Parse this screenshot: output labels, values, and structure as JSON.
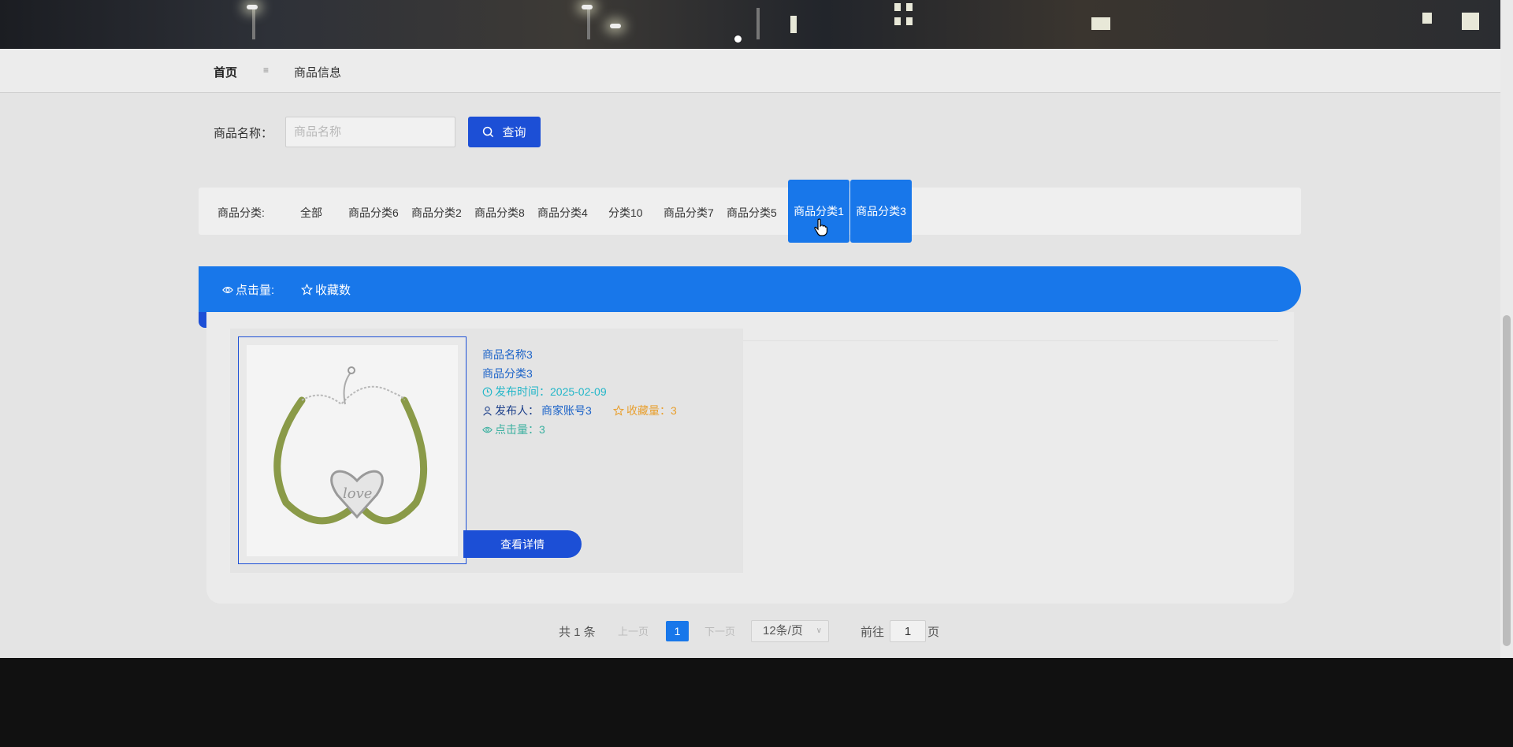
{
  "nav": {
    "home": "首页",
    "separator": "≡",
    "current": "商品信息"
  },
  "search": {
    "label": "商品名称：",
    "placeholder": "商品名称",
    "button": "查询"
  },
  "categories": {
    "label": "商品分类:",
    "items": [
      "全部",
      "商品分类6",
      "商品分类2",
      "商品分类8",
      "商品分类4",
      "分类10",
      "商品分类7",
      "商品分类5"
    ],
    "active": [
      "商品分类1",
      "商品分类3"
    ]
  },
  "sort": {
    "clicks": "点击量:",
    "favorites": "收藏数"
  },
  "product": {
    "name": "商品名称3",
    "category": "商品分类3",
    "publish_time": "发布时间：2025-02-09",
    "publisher_label": "发布人：",
    "publisher": "商家账号3",
    "favorites": "收藏量：3",
    "clicks": "点击量：3",
    "detail_button": "查看详情"
  },
  "pagination": {
    "total": "共 1 条",
    "prev": "上一页",
    "current": "1",
    "next": "下一页",
    "page_size": "12条/页",
    "goto_label": "前往",
    "goto_value": "1",
    "page_suffix": "页"
  },
  "colors": {
    "primary": "#1877ea",
    "primary_dark": "#1c4fd6",
    "time": "#22b6c8",
    "favorites": "#e8a030",
    "clicks": "#3bb0a0",
    "link": "#1c63c8"
  }
}
